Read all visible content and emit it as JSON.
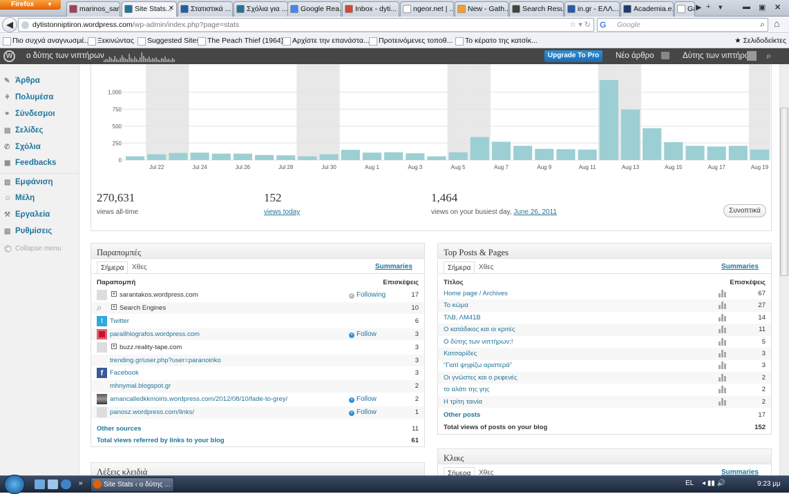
{
  "browser": {
    "app_name": "Firefox",
    "tabs": [
      {
        "label": "marinos_sar...",
        "color": "#a0425a",
        "left": 0
      },
      {
        "label": "Site Stats...",
        "color": "#21759b",
        "active": true
      },
      {
        "label": "Στατιστικά ...",
        "color": "#1e5fa8"
      },
      {
        "label": "Σχόλια για ...",
        "color": "#21759b"
      },
      {
        "label": "Google Rea...",
        "color": "#4285f4"
      },
      {
        "label": "Inbox - dyti...",
        "color": "#d14836"
      },
      {
        "label": "ngeor.net | ...",
        "color": "#ffffff"
      },
      {
        "label": "New - Gath...",
        "color": "#f0a030"
      },
      {
        "label": "Search Resu...",
        "color": "#444444"
      },
      {
        "label": "in.gr - ΕΛΛ...",
        "color": "#2b5aa6"
      },
      {
        "label": "Academia.e...",
        "color": "#1f3c6a"
      },
      {
        "label": "Ga",
        "color": "#ffffff"
      }
    ],
    "url_host": "dytistonniptiron.wordpress.com",
    "url_path": "/wp-admin/index.php?page=stats",
    "search_placeholder": "Google",
    "bookmarks": [
      "Πιο συχνά αναγνωσμέ...",
      "Ξεκινώντας",
      "Suggested Sites",
      "The Peach Thief (1964)...",
      "Αρχίστε την επανάστα...",
      "Προτεινόμενες τοποθ...",
      "Το κέρατο της κατσίκ..."
    ],
    "bookmarks_menu": "Σελιδοδείκτες"
  },
  "wpbar": {
    "site_name": "ο δύτης των νιπτήρων",
    "upgrade": "Upgrade To Pro",
    "new_post": "Νέο άρθρο",
    "user": "Δύτης των νιπτήρων"
  },
  "sidebar": {
    "items": [
      {
        "label": "Άρθρα",
        "icon": "pin-icon"
      },
      {
        "label": "Πολυμέσα",
        "icon": "media-icon"
      },
      {
        "label": "Σύνδεσμοι",
        "icon": "links-icon"
      },
      {
        "label": "Σελίδες",
        "icon": "pages-icon"
      },
      {
        "label": "Σχόλια",
        "icon": "comments-icon"
      },
      {
        "label": "Feedbacks",
        "icon": "feedback-icon"
      },
      {
        "label": "Εμφάνιση",
        "icon": "appearance-icon"
      },
      {
        "label": "Μέλη",
        "icon": "users-icon"
      },
      {
        "label": "Εργαλεία",
        "icon": "tools-icon"
      },
      {
        "label": "Ρυθμίσεις",
        "icon": "settings-icon"
      }
    ],
    "collapse": "Collapse menu"
  },
  "chart_data": {
    "type": "bar",
    "ylim": [
      0,
      1200
    ],
    "yticks": [
      0,
      250,
      500,
      750,
      "1,000"
    ],
    "xtick_labels": [
      "Jul 22",
      "Jul 24",
      "Jul 26",
      "Jul 28",
      "Jul 30",
      "Aug 1",
      "Aug 3",
      "Aug 5",
      "Aug 7",
      "Aug 9",
      "Aug 11",
      "Aug 13",
      "Aug 15",
      "Aug 17",
      "Aug 19"
    ],
    "categories": [
      "Jul 21",
      "Jul 22",
      "Jul 23",
      "Jul 24",
      "Jul 25",
      "Jul 26",
      "Jul 27",
      "Jul 28",
      "Jul 29",
      "Jul 30",
      "Jul 31",
      "Aug 1",
      "Aug 2",
      "Aug 3",
      "Aug 4",
      "Aug 5",
      "Aug 6",
      "Aug 7",
      "Aug 8",
      "Aug 9",
      "Aug 10",
      "Aug 11",
      "Aug 12",
      "Aug 13",
      "Aug 14",
      "Aug 15",
      "Aug 16",
      "Aug 17",
      "Aug 18",
      "Aug 19"
    ],
    "values": [
      55,
      85,
      105,
      110,
      95,
      95,
      75,
      70,
      55,
      85,
      150,
      110,
      115,
      100,
      55,
      115,
      340,
      270,
      210,
      165,
      160,
      155,
      1180,
      745,
      470,
      265,
      210,
      200,
      210,
      155
    ],
    "bar_color": "#9ccfd3",
    "weekend_shade": "#e8e8e8"
  },
  "stats": [
    {
      "value": "270,631",
      "label": "views all-time"
    },
    {
      "value": "152",
      "label": "views today"
    },
    {
      "value": "1,464",
      "label": "views on your busiest day,",
      "link": "June 26, 2011"
    }
  ],
  "summary_button": "Συνοπτικά",
  "referrers": {
    "title": "Παραπομπές",
    "tab_today": "Σήμερα",
    "tab_yesterday": "Χθες",
    "summaries": "Summaries",
    "col_left": "Παραπομπή",
    "col_right": "Επισκέψεις",
    "rows": [
      {
        "label": "sarantakos.wordpress.com",
        "count": "17",
        "expand": true,
        "follow": "Following",
        "followed": true,
        "icon": "blank"
      },
      {
        "label": "Search Engines",
        "count": "10",
        "expand": true,
        "icon": "search"
      },
      {
        "label": "Twitter",
        "count": "6",
        "icon": "twitter",
        "link": true
      },
      {
        "label": "paraIlhlografos.wordpress.com",
        "count": "3",
        "follow": "Follow",
        "icon": "red",
        "link": true
      },
      {
        "label": "buzz.reality-tape.com",
        "count": "3",
        "expand": true,
        "icon": "blank"
      },
      {
        "label": "trending.gr/user.php?user=paranoiriko",
        "count": "3",
        "icon": "none",
        "link": true
      },
      {
        "label": "Facebook",
        "count": "3",
        "icon": "facebook",
        "link": true
      },
      {
        "label": "mhnymal.blogspot.gr",
        "count": "2",
        "icon": "none",
        "link": true
      },
      {
        "label": "amancalledkkmoiris.wordpress.com/2012/08/10/fade-to-grey/",
        "count": "2",
        "follow": "Follow",
        "icon": "photo",
        "link": true
      },
      {
        "label": "panosz.wordpress.com/links/",
        "count": "1",
        "follow": "Follow",
        "icon": "blank",
        "link": true
      }
    ],
    "other_sources": "Other sources",
    "other_count": "11",
    "total_label": "Total views referred by links to your blog",
    "total_count": "61"
  },
  "top_posts": {
    "title": "Top Posts & Pages",
    "tab_today": "Σήμερα",
    "tab_yesterday": "Χθες",
    "summaries": "Summaries",
    "col_left": "Τίτλος",
    "col_right": "Επισκέψεις",
    "rows": [
      {
        "label": "Home page / Archives",
        "count": "67"
      },
      {
        "label": "Το κώμα",
        "count": "27"
      },
      {
        "label": "ΤΛΒ, ΛΜ41Β",
        "count": "14"
      },
      {
        "label": "Ο κατάδικος και οι κριτές",
        "count": "11"
      },
      {
        "label": "Ο δύτης των νιπτήρων;!",
        "count": "5"
      },
      {
        "label": "Κατσαρίδες",
        "count": "3"
      },
      {
        "label": "“Γιατί ψηφίζω αριστερά”",
        "count": "3"
      },
      {
        "label": "Οι γνώστες και ο ρεφενές",
        "count": "2"
      },
      {
        "label": "το αλάτι της γης",
        "count": "2"
      },
      {
        "label": "Η τρίτη ταινία",
        "count": "2"
      }
    ],
    "other_posts": "Other posts",
    "other_count": "17",
    "total_label": "Total views of posts on your blog",
    "total_count": "152"
  },
  "keywords_title": "Λέξεις κλειδιά",
  "clicks": {
    "title": "Κλικς",
    "tab_today": "Σήμερα",
    "tab_yesterday": "Χθες",
    "summaries": "Summaries"
  },
  "taskbar": {
    "task": "Site Stats ‹ ο δύτης ...",
    "lang": "EL",
    "clock": "9:23 μμ"
  }
}
